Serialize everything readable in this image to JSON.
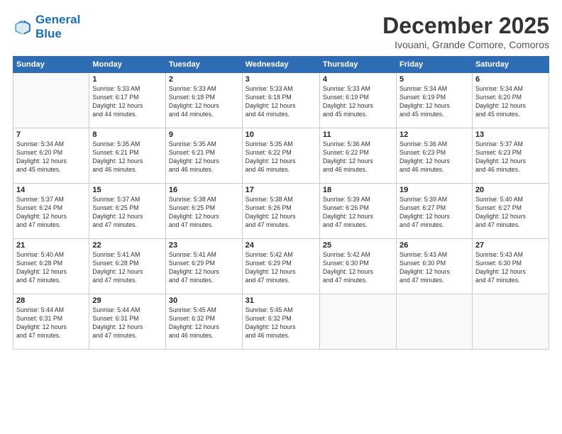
{
  "logo": {
    "line1": "General",
    "line2": "Blue"
  },
  "title": "December 2025",
  "subtitle": "Ivouani, Grande Comore, Comoros",
  "days_of_week": [
    "Sunday",
    "Monday",
    "Tuesday",
    "Wednesday",
    "Thursday",
    "Friday",
    "Saturday"
  ],
  "weeks": [
    [
      {
        "num": "",
        "info": ""
      },
      {
        "num": "1",
        "info": "Sunrise: 5:33 AM\nSunset: 6:17 PM\nDaylight: 12 hours\nand 44 minutes."
      },
      {
        "num": "2",
        "info": "Sunrise: 5:33 AM\nSunset: 6:18 PM\nDaylight: 12 hours\nand 44 minutes."
      },
      {
        "num": "3",
        "info": "Sunrise: 5:33 AM\nSunset: 6:18 PM\nDaylight: 12 hours\nand 44 minutes."
      },
      {
        "num": "4",
        "info": "Sunrise: 5:33 AM\nSunset: 6:19 PM\nDaylight: 12 hours\nand 45 minutes."
      },
      {
        "num": "5",
        "info": "Sunrise: 5:34 AM\nSunset: 6:19 PM\nDaylight: 12 hours\nand 45 minutes."
      },
      {
        "num": "6",
        "info": "Sunrise: 5:34 AM\nSunset: 6:20 PM\nDaylight: 12 hours\nand 45 minutes."
      }
    ],
    [
      {
        "num": "7",
        "info": "Sunrise: 5:34 AM\nSunset: 6:20 PM\nDaylight: 12 hours\nand 45 minutes."
      },
      {
        "num": "8",
        "info": "Sunrise: 5:35 AM\nSunset: 6:21 PM\nDaylight: 12 hours\nand 46 minutes."
      },
      {
        "num": "9",
        "info": "Sunrise: 5:35 AM\nSunset: 6:21 PM\nDaylight: 12 hours\nand 46 minutes."
      },
      {
        "num": "10",
        "info": "Sunrise: 5:35 AM\nSunset: 6:22 PM\nDaylight: 12 hours\nand 46 minutes."
      },
      {
        "num": "11",
        "info": "Sunrise: 5:36 AM\nSunset: 6:22 PM\nDaylight: 12 hours\nand 46 minutes."
      },
      {
        "num": "12",
        "info": "Sunrise: 5:36 AM\nSunset: 6:23 PM\nDaylight: 12 hours\nand 46 minutes."
      },
      {
        "num": "13",
        "info": "Sunrise: 5:37 AM\nSunset: 6:23 PM\nDaylight: 12 hours\nand 46 minutes."
      }
    ],
    [
      {
        "num": "14",
        "info": "Sunrise: 5:37 AM\nSunset: 6:24 PM\nDaylight: 12 hours\nand 47 minutes."
      },
      {
        "num": "15",
        "info": "Sunrise: 5:37 AM\nSunset: 6:25 PM\nDaylight: 12 hours\nand 47 minutes."
      },
      {
        "num": "16",
        "info": "Sunrise: 5:38 AM\nSunset: 6:25 PM\nDaylight: 12 hours\nand 47 minutes."
      },
      {
        "num": "17",
        "info": "Sunrise: 5:38 AM\nSunset: 6:26 PM\nDaylight: 12 hours\nand 47 minutes."
      },
      {
        "num": "18",
        "info": "Sunrise: 5:39 AM\nSunset: 6:26 PM\nDaylight: 12 hours\nand 47 minutes."
      },
      {
        "num": "19",
        "info": "Sunrise: 5:39 AM\nSunset: 6:27 PM\nDaylight: 12 hours\nand 47 minutes."
      },
      {
        "num": "20",
        "info": "Sunrise: 5:40 AM\nSunset: 6:27 PM\nDaylight: 12 hours\nand 47 minutes."
      }
    ],
    [
      {
        "num": "21",
        "info": "Sunrise: 5:40 AM\nSunset: 6:28 PM\nDaylight: 12 hours\nand 47 minutes."
      },
      {
        "num": "22",
        "info": "Sunrise: 5:41 AM\nSunset: 6:28 PM\nDaylight: 12 hours\nand 47 minutes."
      },
      {
        "num": "23",
        "info": "Sunrise: 5:41 AM\nSunset: 6:29 PM\nDaylight: 12 hours\nand 47 minutes."
      },
      {
        "num": "24",
        "info": "Sunrise: 5:42 AM\nSunset: 6:29 PM\nDaylight: 12 hours\nand 47 minutes."
      },
      {
        "num": "25",
        "info": "Sunrise: 5:42 AM\nSunset: 6:30 PM\nDaylight: 12 hours\nand 47 minutes."
      },
      {
        "num": "26",
        "info": "Sunrise: 5:43 AM\nSunset: 6:30 PM\nDaylight: 12 hours\nand 47 minutes."
      },
      {
        "num": "27",
        "info": "Sunrise: 5:43 AM\nSunset: 6:30 PM\nDaylight: 12 hours\nand 47 minutes."
      }
    ],
    [
      {
        "num": "28",
        "info": "Sunrise: 5:44 AM\nSunset: 6:31 PM\nDaylight: 12 hours\nand 47 minutes."
      },
      {
        "num": "29",
        "info": "Sunrise: 5:44 AM\nSunset: 6:31 PM\nDaylight: 12 hours\nand 47 minutes."
      },
      {
        "num": "30",
        "info": "Sunrise: 5:45 AM\nSunset: 6:32 PM\nDaylight: 12 hours\nand 46 minutes."
      },
      {
        "num": "31",
        "info": "Sunrise: 5:45 AM\nSunset: 6:32 PM\nDaylight: 12 hours\nand 46 minutes."
      },
      {
        "num": "",
        "info": ""
      },
      {
        "num": "",
        "info": ""
      },
      {
        "num": "",
        "info": ""
      }
    ]
  ]
}
